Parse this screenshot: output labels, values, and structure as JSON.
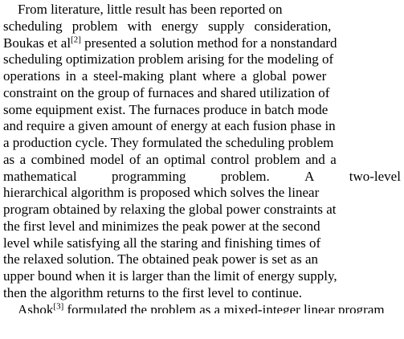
{
  "paragraph": {
    "lines": [
      [
        "From literature, little result has been reported on"
      ],
      [
        "scheduling problem with energy supply consideration,"
      ],
      [
        "Boukas et al",
        "[2]",
        " presented a solution method for a nonstandard"
      ],
      [
        "scheduling optimization problem arising for the modeling of"
      ],
      [
        "operations in a steel-making plant where a global power"
      ],
      [
        "constraint on the group of furnaces and shared utilization of"
      ],
      [
        "some equipment exist.  The furnaces produce in batch mode"
      ],
      [
        "and require a given amount of energy at each fusion phase in"
      ],
      [
        "a production cycle.  They formulated the scheduling problem"
      ],
      [
        "as a combined model of an optimal control problem and a"
      ],
      [
        "mathematical",
        "programming",
        "problem.",
        "A",
        "two-level"
      ],
      [
        "hierarchical algorithm is proposed which solves the linear"
      ],
      [
        "program obtained by relaxing the global power constraints at"
      ],
      [
        "the first level and minimizes the peak power at the second"
      ],
      [
        "level while satisfying all the staring and finishing times of"
      ],
      [
        "the relaxed solution.  The obtained peak power is set as an"
      ],
      [
        "upper bound when it is larger than the limit of energy supply,"
      ],
      [
        "then the algorithm returns to the first level to continue."
      ]
    ],
    "cut_line": [
      "Ashok",
      "[3]",
      " formulated the problem as a mixed-integer linear program"
    ]
  }
}
